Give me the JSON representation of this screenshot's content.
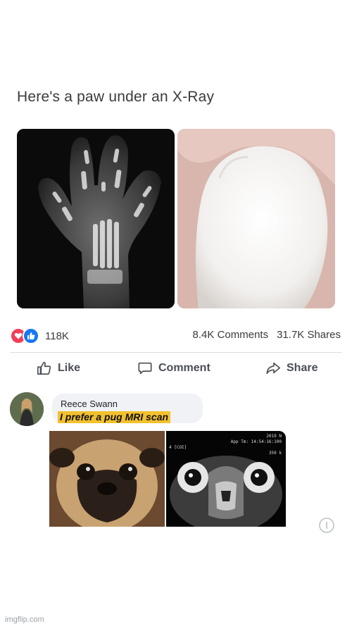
{
  "post": {
    "title": "Here's a paw under an X-Ray"
  },
  "stats": {
    "reaction_count": "118K",
    "comments": "8.4K Comments",
    "shares": "31.7K Shares"
  },
  "actions": {
    "like": "Like",
    "comment": "Comment",
    "share": "Share"
  },
  "comment": {
    "author": "Reece Swann",
    "text": "I prefer a pug MRI scan",
    "mri_labels": [
      "2019 N",
      "App Tm: 14:54:16:100",
      "4 [COI]",
      "350 k"
    ]
  },
  "watermark": "imgflip.com",
  "colors": {
    "love": "#f33e58",
    "like": "#1877f2",
    "highlight": "#f2c12e"
  },
  "icons": [
    "love-reaction-icon",
    "like-reaction-icon",
    "thumbs-up-icon",
    "comment-icon",
    "share-icon",
    "info-icon"
  ]
}
